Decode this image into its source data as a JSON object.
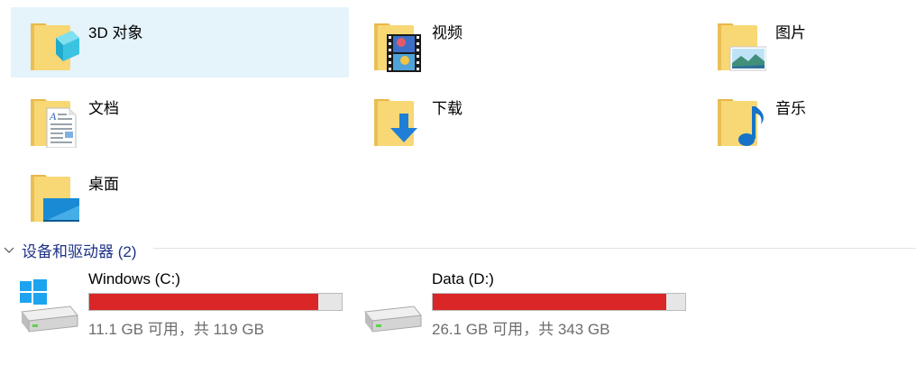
{
  "folders": [
    {
      "name": "3D 对象",
      "icon": "3d-objects-folder-icon"
    },
    {
      "name": "视频",
      "icon": "videos-folder-icon"
    },
    {
      "name": "图片",
      "icon": "pictures-folder-icon"
    },
    {
      "name": "文档",
      "icon": "documents-folder-icon"
    },
    {
      "name": "下载",
      "icon": "downloads-folder-icon"
    },
    {
      "name": "音乐",
      "icon": "music-folder-icon"
    },
    {
      "name": "桌面",
      "icon": "desktop-folder-icon"
    }
  ],
  "devices_section": {
    "title": "设备和驱动器 (2)",
    "expanded": true
  },
  "drives": [
    {
      "name": "Windows (C:)",
      "free_text": "11.1 GB 可用，共 119 GB",
      "used_fraction": 0.907,
      "icon": "windows-drive-icon"
    },
    {
      "name": "Data (D:)",
      "free_text": "26.1 GB 可用，共 343 GB",
      "used_fraction": 0.924,
      "icon": "data-drive-icon"
    }
  ],
  "colors": {
    "selection_bg": "#e5f3fb",
    "section_title": "#1e3287",
    "usage_bar_critical": "#da2626",
    "usage_bar_track": "#e6e6e6",
    "folder_yellow": "#f8d775",
    "secondary_text": "#6d6d6d"
  }
}
